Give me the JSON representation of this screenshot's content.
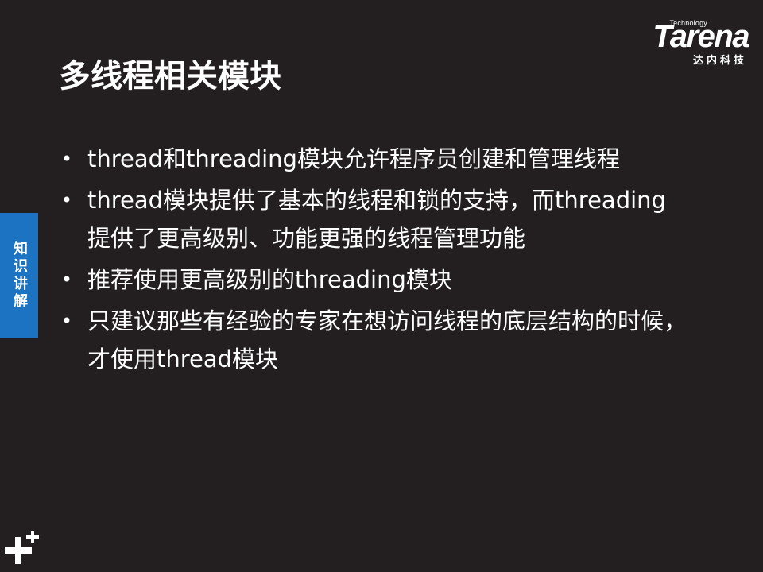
{
  "logo": {
    "technology": "Technology",
    "wordmark": "Tarena",
    "chinese": "达内科技"
  },
  "slide": {
    "title": "多线程相关模块",
    "side_tab": "知识讲解",
    "bullet_symbol": "•",
    "bullets": [
      "thread和threading模块允许程序员创建和管理线程",
      "thread模块提供了基本的线程和锁的支持，而threading提供了更高级别、功能更强的线程管理功能",
      "推荐使用更高级别的threading模块",
      "只建议那些有经验的专家在想访问线程的底层结构的时候，才使用thread模块"
    ]
  },
  "icons": {
    "corner": "plus-plus-icon"
  }
}
